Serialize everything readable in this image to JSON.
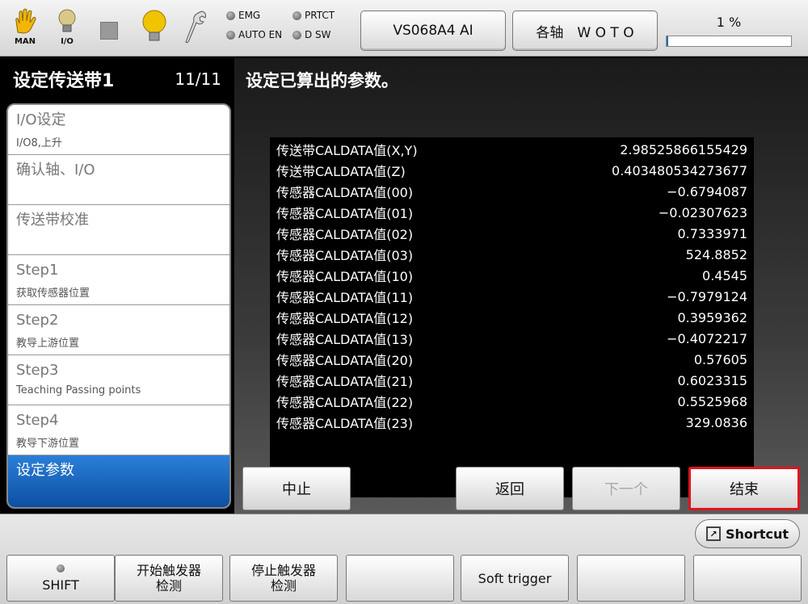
{
  "topbar": {
    "man_caption": "MAN",
    "io_caption": "I/O",
    "leds": [
      {
        "label": "EMG"
      },
      {
        "label": "PRTCT"
      },
      {
        "label": "AUTO EN"
      },
      {
        "label": "D SW"
      }
    ],
    "robot_button": "VS068A4 AI",
    "axis_button": "各轴　W O T O",
    "progress_text": "1 %",
    "progress_value": 1
  },
  "left": {
    "title": "设定传送带1",
    "page_counter": "11/11",
    "steps": [
      {
        "line1": "I/O设定",
        "line2": "I/O8,上升"
      },
      {
        "line1": "确认轴、I/O",
        "line2": ""
      },
      {
        "line1": "传送带校准",
        "line2": ""
      },
      {
        "line1": "Step1",
        "line2": "获取传感器位置"
      },
      {
        "line1": "Step2",
        "line2": "教导上游位置"
      },
      {
        "line1": "Step3",
        "line2": "Teaching Passing points"
      },
      {
        "line1": "Step4",
        "line2": "教导下游位置"
      },
      {
        "line1": "设定参数",
        "line2": ""
      }
    ]
  },
  "main": {
    "title": "设定已算出的参数。",
    "params": [
      {
        "name": "传送带CALDATA值(X,Y)",
        "value": "2.98525866155429"
      },
      {
        "name": "传送带CALDATA值(Z)",
        "value": "0.403480534273677"
      },
      {
        "name": "传感器CALDATA值(00)",
        "value": "−0.6794087"
      },
      {
        "name": "传感器CALDATA值(01)",
        "value": "−0.02307623"
      },
      {
        "name": "传感器CALDATA值(02)",
        "value": "0.7333971"
      },
      {
        "name": "传感器CALDATA值(03)",
        "value": "524.8852"
      },
      {
        "name": "传感器CALDATA值(10)",
        "value": "0.4545"
      },
      {
        "name": "传感器CALDATA值(11)",
        "value": "−0.7979124"
      },
      {
        "name": "传感器CALDATA值(12)",
        "value": "0.3959362"
      },
      {
        "name": "传感器CALDATA值(13)",
        "value": "−0.4072217"
      },
      {
        "name": "传感器CALDATA值(20)",
        "value": "0.57605"
      },
      {
        "name": "传感器CALDATA值(21)",
        "value": "0.6023315"
      },
      {
        "name": "传感器CALDATA值(22)",
        "value": "0.5525968"
      },
      {
        "name": "传感器CALDATA值(23)",
        "value": "329.0836"
      }
    ],
    "buttons": {
      "abort": "中止",
      "back": "返回",
      "next": "下一个",
      "finish": "结束"
    }
  },
  "bottom": {
    "shortcut": "Shortcut",
    "shift": "SHIFT",
    "f2_line1": "开始触发器",
    "f2_line2": "检测",
    "f3_line1": "停止触发器",
    "f3_line2": "检测",
    "f5": "Soft trigger"
  }
}
